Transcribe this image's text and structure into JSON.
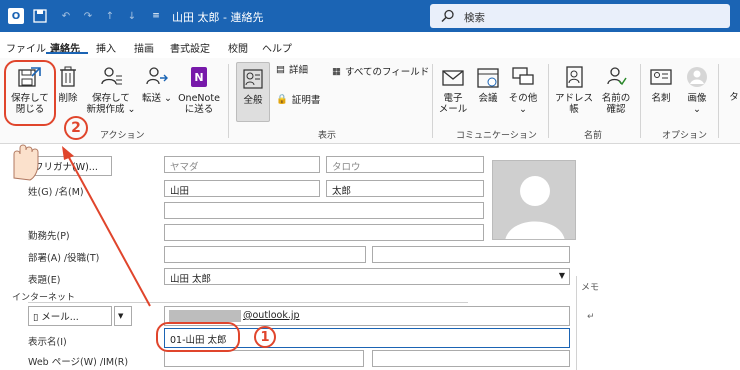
{
  "titlebar": {
    "title": "山田 太郎 - 連絡先",
    "search_placeholder": "検索"
  },
  "menubar": {
    "items": [
      "ファイル",
      "連絡先",
      "挿入",
      "描画",
      "書式設定",
      "校閲",
      "ヘルプ"
    ]
  },
  "ribbon": {
    "actions": {
      "save_close": [
        "保存して",
        "閉じる"
      ],
      "delete": "削除",
      "save_new": [
        "保存して",
        "新規作成 ⌄"
      ],
      "label": "アクション"
    },
    "forward": "転送 ⌄",
    "onenote": [
      "OneNote",
      "に送る"
    ],
    "display": {
      "general": "全般",
      "details": "詳細",
      "certificates": "証明書",
      "all_fields": "すべてのフィールド",
      "label": "表示"
    },
    "communication": {
      "email": [
        "電子",
        "メール"
      ],
      "meeting": "会議",
      "more": [
        "その他",
        "⌄"
      ],
      "label": "コミュニケーション"
    },
    "names": {
      "address_book": "アドレス帳",
      "check_names": [
        "名前の",
        "確認"
      ],
      "label": "名前"
    },
    "options": {
      "business_card": "名刺",
      "picture": [
        "画像",
        "⌄"
      ],
      "label": "オプション",
      "more": "タ"
    }
  },
  "form": {
    "furigana_label": "フリガナ(W)...",
    "furigana_last": "ヤマダ",
    "furigana_first": "タロウ",
    "name_label": "姓(G) /名(M)",
    "last_name": "山田",
    "first_name": "太郎",
    "company_label": "勤務先(P)",
    "dept_label": "部署(A) /役職(T)",
    "fileas_label": "表題(E)",
    "fileas_value": "山田 太郎",
    "internet_label": "インターネット",
    "email_type": "メール...",
    "email_value": "@outlook.jp",
    "display_name_label": "表示名(I)",
    "display_name_value": "01-山田 太郎",
    "web_label": "Web ページ(W) /IM(R)",
    "memo_label": "メモ",
    "memo_mark": "↵"
  },
  "annotations": {
    "marker_1": "1",
    "marker_2": "2"
  },
  "colors": {
    "title_bar": "#1b64b4",
    "annotation": "#e0452c",
    "onenote": "#7719aa"
  }
}
